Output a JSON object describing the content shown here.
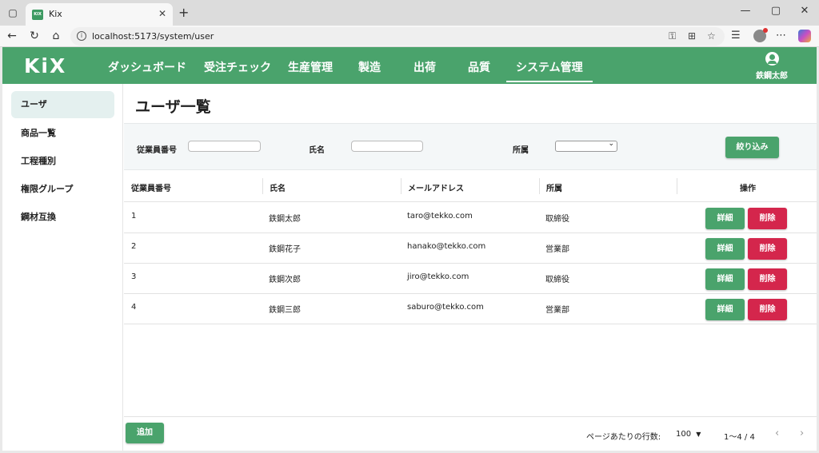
{
  "browser": {
    "tab_title": "Kix",
    "favicon_text": "KIX",
    "url": "localhost:5173/system/user"
  },
  "app": {
    "logo": "KiX",
    "nav": [
      "ダッシュボード",
      "受注チェック",
      "生産管理",
      "製造",
      "出荷",
      "品質",
      "システム管理"
    ],
    "active_nav": "システム管理",
    "user_name": "鉄鋼太郎",
    "accent_color": "#4aa36c",
    "danger_color": "#d4264c"
  },
  "sidebar": {
    "items": [
      {
        "label": "ユーザ"
      },
      {
        "label": "商品一覧"
      },
      {
        "label": "工程種別"
      },
      {
        "label": "権限グループ"
      },
      {
        "label": "鋼材互換"
      }
    ],
    "active": "ユーザ"
  },
  "page": {
    "title": "ユーザ一覧"
  },
  "filter": {
    "employee_no_label": "従業員番号",
    "employee_no_value": "",
    "name_label": "氏名",
    "name_value": "",
    "dept_label": "所属",
    "dept_value": "",
    "submit_label": "絞り込み"
  },
  "table": {
    "columns": [
      "従業員番号",
      "氏名",
      "メールアドレス",
      "所属",
      "操作"
    ],
    "rows": [
      {
        "id": "1",
        "name": "鉄鋼太郎",
        "email": "taro@tekko.com",
        "dept": "取締役"
      },
      {
        "id": "2",
        "name": "鉄鋼花子",
        "email": "hanako@tekko.com",
        "dept": "営業部"
      },
      {
        "id": "3",
        "name": "鉄鋼次郎",
        "email": "jiro@tekko.com",
        "dept": "取締役"
      },
      {
        "id": "4",
        "name": "鉄鋼三郎",
        "email": "saburo@tekko.com",
        "dept": "営業部"
      }
    ],
    "detail_label": "詳細",
    "delete_label": "削除"
  },
  "footer": {
    "add_label": "追加",
    "rows_per_page_label": "ページあたりの行数:",
    "rows_per_page": "100",
    "range": "1〜4 / 4"
  }
}
